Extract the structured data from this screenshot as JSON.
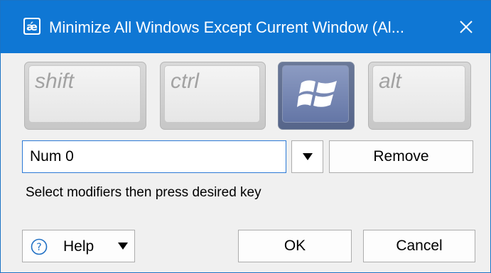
{
  "window": {
    "title": "Minimize All Windows Except Current Window (Al...",
    "close_glyph": "✕"
  },
  "modifiers": [
    {
      "label": "shift",
      "active": false
    },
    {
      "label": "ctrl",
      "active": false
    },
    {
      "label": "windows-logo-icon",
      "active": true
    },
    {
      "label": "alt",
      "active": false
    }
  ],
  "key_field": {
    "value": "Num 0"
  },
  "buttons": {
    "remove": "Remove",
    "ok": "OK",
    "cancel": "Cancel",
    "help": "Help"
  },
  "hint": "Select modifiers then press desired key",
  "icons": {
    "title": "hotkey-app-icon",
    "close": "close-icon",
    "dropdown": "triangle-down-icon",
    "help": "question-circle-icon"
  },
  "colors": {
    "titlebar": "#0f77d4",
    "active_key": "#6476a6",
    "focus_border": "#2b79d6"
  }
}
